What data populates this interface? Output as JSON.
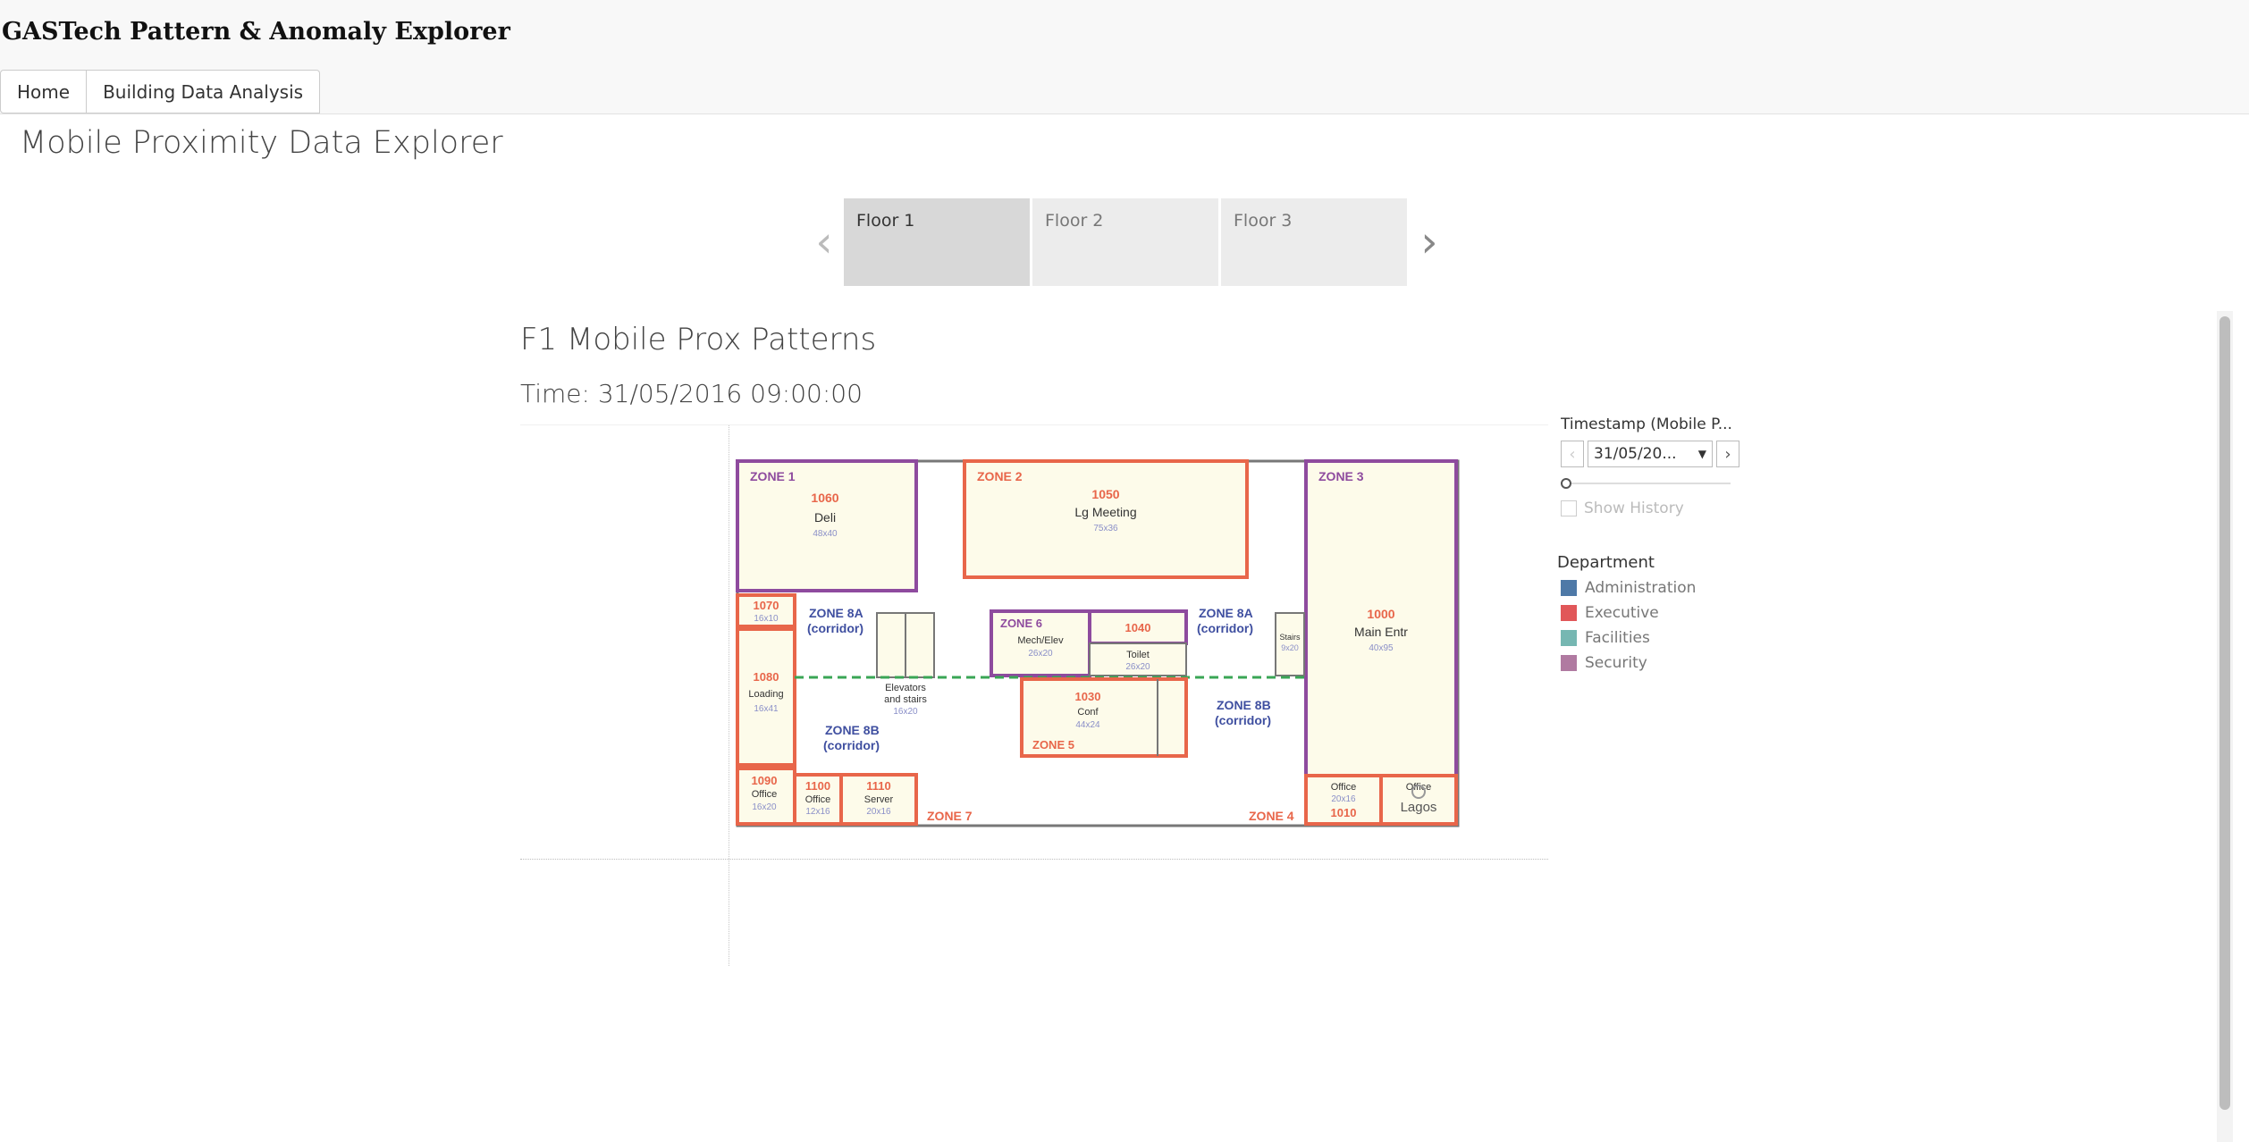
{
  "header": {
    "title": "GASTech Pattern & Anomaly Explorer",
    "nav": [
      {
        "label": "Home"
      },
      {
        "label": "Building Data Analysis"
      }
    ]
  },
  "page": {
    "title": "Mobile Proximity Data Explorer"
  },
  "floor_tabs": [
    {
      "label": "Floor 1",
      "active": true
    },
    {
      "label": "Floor 2"
    },
    {
      "label": "Floor 3"
    }
  ],
  "viz": {
    "title": "F1 Mobile Prox Patterns",
    "subtitle": "Time: 31/05/2016 09:00:00"
  },
  "floorplan": {
    "zones": {
      "z1": "ZONE 1",
      "z2": "ZONE 2",
      "z3": "ZONE 3",
      "z4": "ZONE 4",
      "z5": "ZONE 5",
      "z6": "ZONE 6",
      "z7": "ZONE 7",
      "z8a_l1": "ZONE 8A",
      "z8a_l2": "(corridor)",
      "z8a2_l1": "ZONE 8A",
      "z8a2_l2": "(corridor)",
      "z8b_l1": "ZONE 8B",
      "z8b_l2": "(corridor)",
      "z8b2_l1": "ZONE 8B",
      "z8b2_l2": "(corridor)"
    },
    "rooms": {
      "r1060": {
        "num": "1060",
        "name": "Deli",
        "dim": "48x40"
      },
      "r1050": {
        "num": "1050",
        "name": "Lg Meeting",
        "dim": "75x36"
      },
      "r1000": {
        "num": "1000",
        "name": "Main Entr",
        "dim": "40x95"
      },
      "r1070": {
        "num": "1070",
        "dim": "16x10"
      },
      "r1080": {
        "num": "1080",
        "name": "Loading",
        "dim": "16x41"
      },
      "r1090": {
        "num": "1090",
        "name": "Office",
        "dim": "16x20"
      },
      "r1100": {
        "num": "1100",
        "name": "Office",
        "dim": "12x16"
      },
      "r1110": {
        "num": "1110",
        "name": "Server",
        "dim": "20x16"
      },
      "r1040": {
        "num": "1040"
      },
      "mech": {
        "name": "Mech/Elev",
        "dim": "26x20"
      },
      "toilet": {
        "name": "Toilet",
        "dim": "26x20"
      },
      "r1030": {
        "num": "1030",
        "name": "Conf",
        "dim": "44x24"
      },
      "stairs": {
        "name": "Stairs",
        "dim": "9x20"
      },
      "elev": {
        "l1": "Elevators",
        "l2": "and stairs",
        "dim": "16x20"
      },
      "r1010": {
        "num": "1010",
        "name": "Office",
        "dim": "20x16"
      },
      "office2": {
        "name": "Office"
      }
    },
    "marker_label": "Lagos"
  },
  "controls": {
    "timestamp_label": "Timestamp (Mobile P...",
    "timestamp_value": "31/05/20...",
    "slider_position": 0,
    "show_history_label": "Show History"
  },
  "legend": {
    "title": "Department",
    "items": [
      {
        "label": "Administration",
        "color": "#4e79a7"
      },
      {
        "label": "Executive",
        "color": "#e15759"
      },
      {
        "label": "Facilities",
        "color": "#76b7b2"
      },
      {
        "label": "Security",
        "color": "#b07aa1"
      }
    ]
  },
  "colors": {
    "purple": "#8e4b9e",
    "orange": "#e8664a",
    "gray": "#666666",
    "corridor": "#3f4fa0",
    "dash": "#3aa655"
  }
}
